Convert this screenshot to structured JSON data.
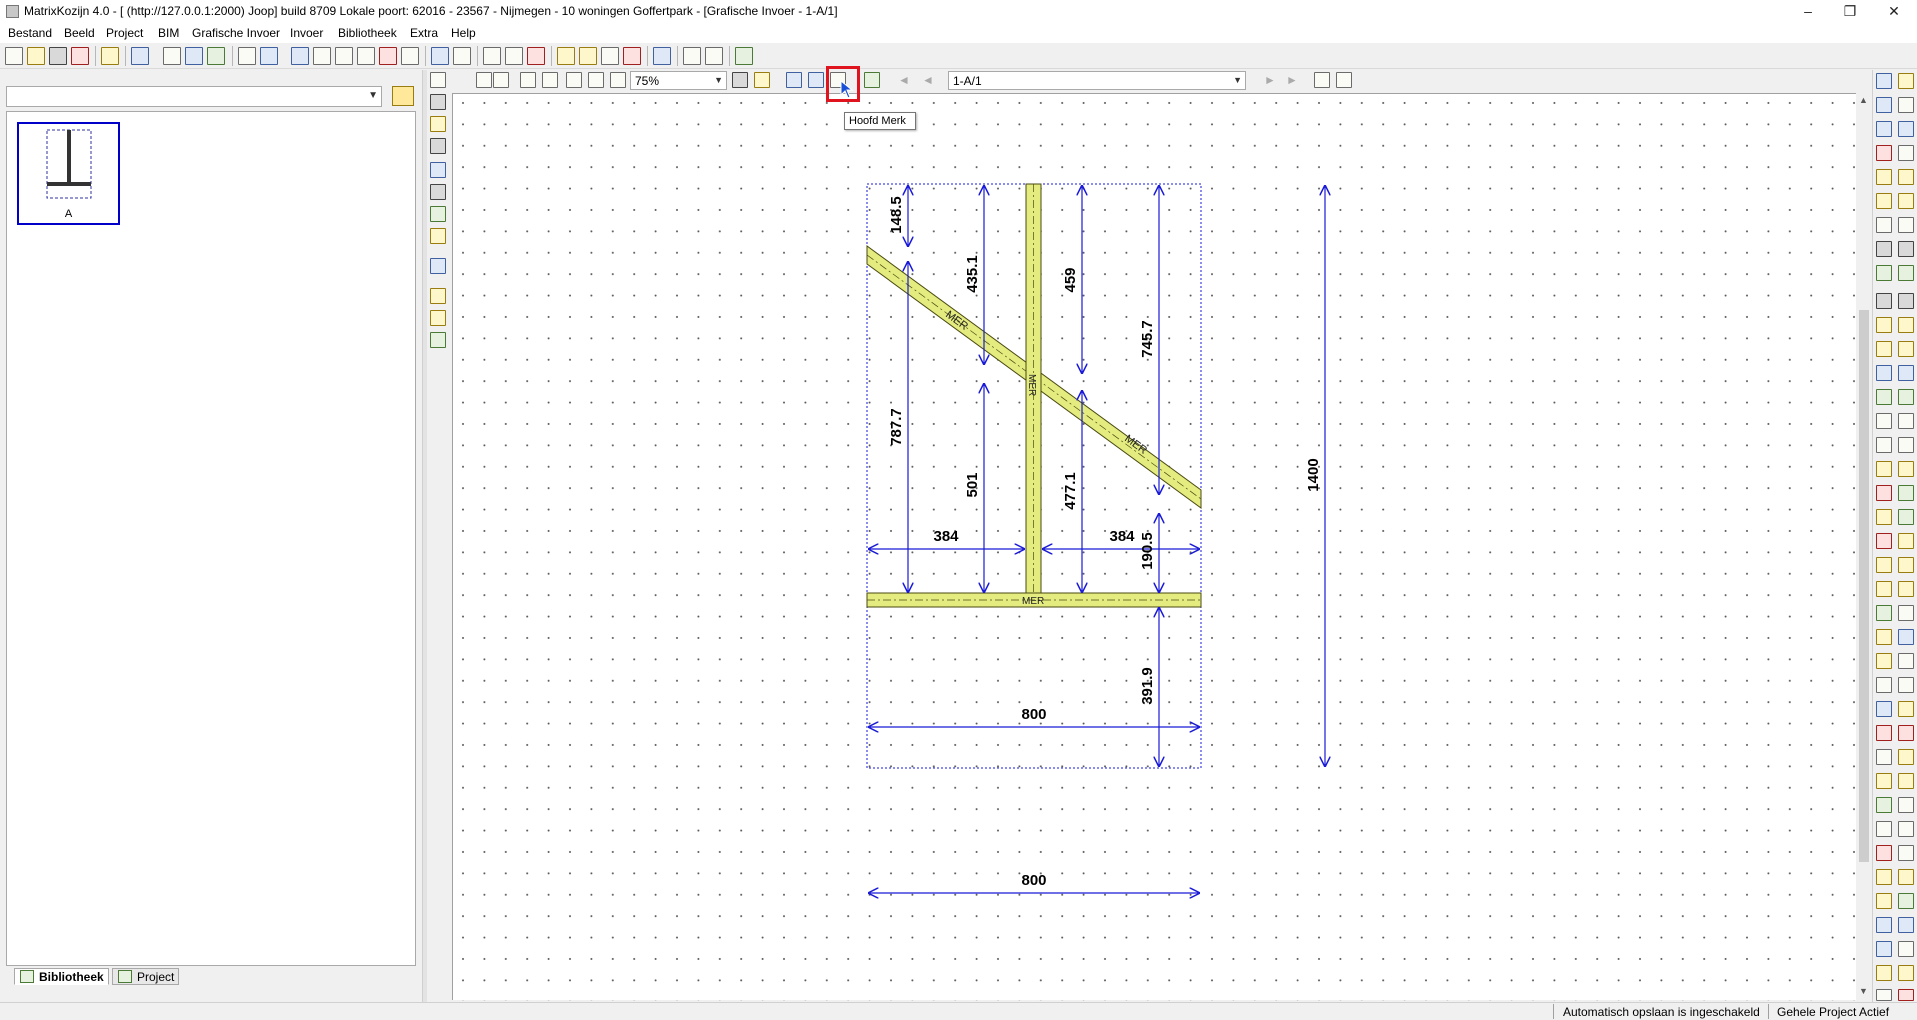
{
  "window": {
    "title": "MatrixKozijn 4.0 - [ (http://127.0.0.1:2000) Joop] build  8709 Lokale poort: 62016 - 23567 - Nijmegen - 10 woningen Goffertpark - [Grafische Invoer - 1-A/1]",
    "minimize": "–",
    "restore": "❐",
    "close": "✕"
  },
  "menu": [
    "Bestand",
    "Beeld",
    "Project",
    "BIM",
    "Grafische Invoer",
    "Invoer",
    "Bibliotheek",
    "Extra",
    "Help"
  ],
  "library": {
    "combo_value": "",
    "item_label": "A"
  },
  "tabs": {
    "bibliotheek": "Bibliotheek",
    "project": "Project"
  },
  "toolbar2": {
    "zoom_value": "75%",
    "page_value": "1-A/1"
  },
  "tooltip": "Hoofd Merk",
  "status": {
    "autosave": "Automatisch opslaan is ingeschakeld",
    "project": "Gehele Project Actief"
  },
  "drawing": {
    "member_label": "MER",
    "dimensions": {
      "d148": "148.5",
      "d435": "435.1",
      "d459": "459",
      "d745": "745.7",
      "d787": "787.7",
      "d501": "501",
      "d477": "477.1",
      "d190": "190.5",
      "d384a": "384",
      "d384b": "384",
      "d391": "391.9",
      "d800a": "800",
      "d800b": "800",
      "d1400": "1400"
    },
    "colors": {
      "member_fill": "#e4ec80",
      "member_stroke": "#4a4a10",
      "dimension": "#1a1ad8",
      "outline": "#1a1ad8"
    }
  }
}
